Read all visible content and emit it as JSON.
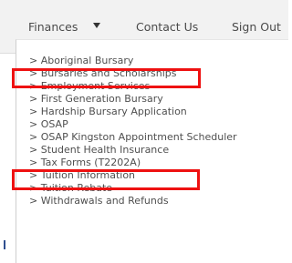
{
  "nav": {
    "finances": "Finances",
    "contact": "Contact Us",
    "signout": "Sign Out"
  },
  "menu": {
    "items": [
      {
        "label": "> Aboriginal Bursary"
      },
      {
        "label": "> Bursaries and Scholarships",
        "highlighted": true
      },
      {
        "label": "> Employment Services"
      },
      {
        "label": "> First Generation Bursary"
      },
      {
        "label": "> Hardship Bursary Application"
      },
      {
        "label": "> OSAP"
      },
      {
        "label": "> OSAP Kingston Appointment Scheduler"
      },
      {
        "label": "> Student Health Insurance",
        "highlighted": true
      },
      {
        "label": "> Tax Forms (T2202A)"
      },
      {
        "label": "> Tuition Information"
      },
      {
        "label": "> Tuition Rebate"
      },
      {
        "label": "> Withdrawals and Refunds"
      }
    ]
  },
  "colors": {
    "highlight": "#ee1111",
    "nav_background": "#f2f2f2",
    "text": "#4f4f4f"
  }
}
